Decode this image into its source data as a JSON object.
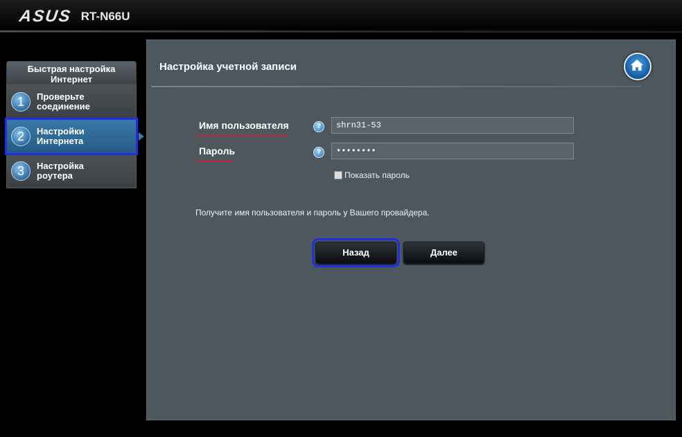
{
  "header": {
    "brand": "ASUS",
    "model": "RT-N66U"
  },
  "sidebar": {
    "title": "Быстрая настройка Интернет",
    "items": [
      {
        "number": "1",
        "label_line1": "Проверьте",
        "label_line2": "соединение"
      },
      {
        "number": "2",
        "label_line1": "Настройки",
        "label_line2": "Интернета"
      },
      {
        "number": "3",
        "label_line1": "Настройка",
        "label_line2": "роутера"
      }
    ],
    "active_index": 1
  },
  "main": {
    "title": "Настройка учетной записи",
    "home_icon": "home-icon",
    "username": {
      "label": "Имя пользователя",
      "value": "shrn31-53"
    },
    "password": {
      "label": "Пароль",
      "value": "••••••••"
    },
    "show_password": {
      "label": "Показать пароль",
      "checked": false
    },
    "hint": "Получите имя пользователя и пароль у Вашего провайдера.",
    "back_label": "Назад",
    "next_label": "Далее"
  },
  "colors": {
    "accent_blue": "#1e2ee0",
    "underline_red": "#c0272d",
    "panel_bg": "#4d585e"
  }
}
